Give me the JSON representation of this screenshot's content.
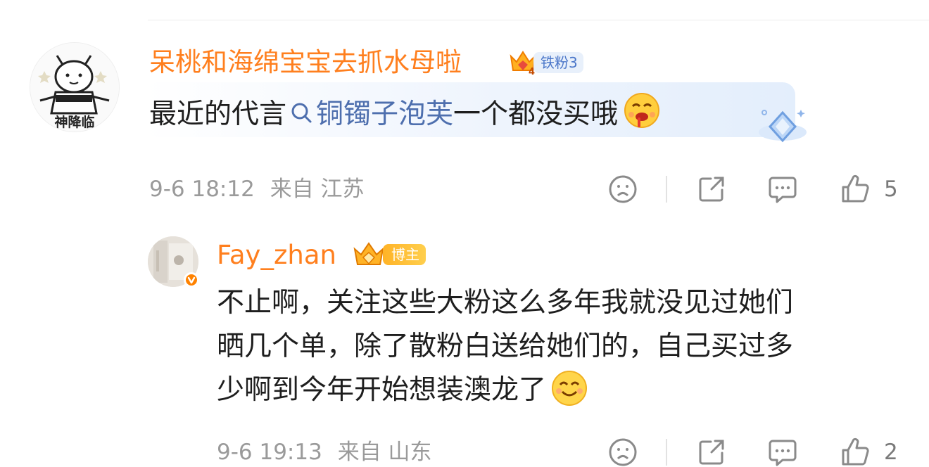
{
  "comments": [
    {
      "username": "呆桃和海绵宝宝去抓水母啦",
      "fan_badge": "铁粉3",
      "avatar_text": "神降临",
      "text_before_topic": "最近的代言",
      "topic": "铜镯子泡芙",
      "text_after_topic": "一个都没买哦",
      "time": "9-6 18:12",
      "location": "来自 江苏",
      "likes": "5"
    },
    {
      "username": "Fay_zhan",
      "fan_badge": "博主",
      "text_lines": [
        "不止啊，关注这些大粉这么多年我就没见过她们",
        "晒几个单，除了散粉白送给她们的，自己买过多",
        "少啊到今年开始想装澳龙了"
      ],
      "time": "9-6 19:13",
      "location": "来自 山东",
      "likes": "2"
    }
  ],
  "icons": {
    "dislike": "sad-face-icon",
    "share": "share-icon",
    "comment": "comment-icon",
    "like": "thumbs-up-icon",
    "topic": "search-icon",
    "verified": "verified-badge-icon"
  },
  "colors": {
    "username": "#ff7f1e",
    "topic_link": "#4e6fae",
    "meta_text": "#9a9a9a",
    "verified": "#ff8200"
  }
}
